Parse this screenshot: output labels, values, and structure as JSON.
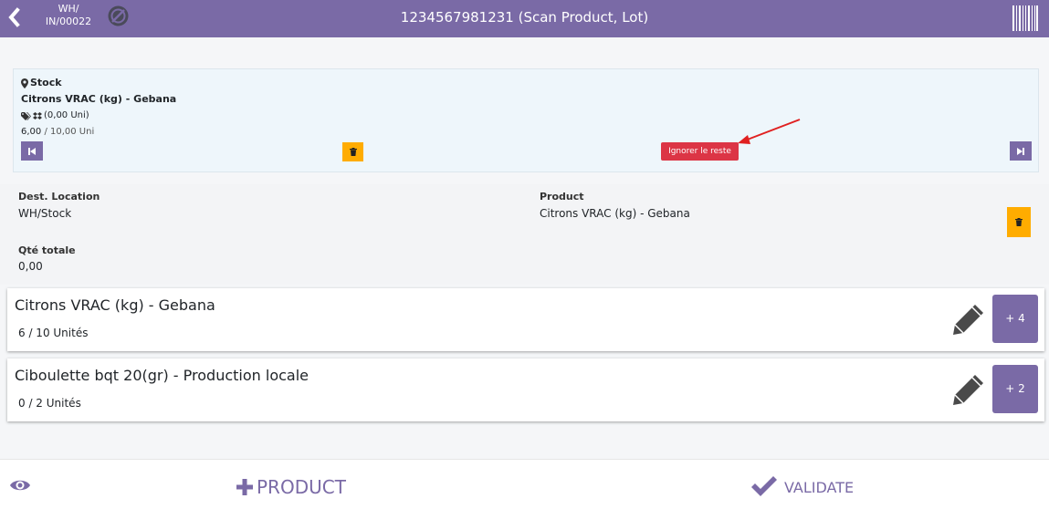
{
  "colors": {
    "primary": "#7a6aa6",
    "warning": "#ffac00",
    "danger": "#dc3545",
    "selected_bg": "#eef6fb",
    "arrow": "#e02020"
  },
  "header": {
    "reference": "WH/ IN/00022",
    "title": "1234567981231 (Scan Product, Lot)",
    "icons": [
      "chevron-left-icon",
      "no-link-icon",
      "barcode-icon"
    ]
  },
  "selected_line": {
    "location": "Stock",
    "product": "Citrons VRAC (kg) - Gebana",
    "package_qty": "(0,00 Uni)",
    "qty_done": "6,00",
    "qty_demand": "/ 10,00 Uni",
    "ignore_label": "Ignorer le reste",
    "icons": [
      "map-marker-icon",
      "tags-icon",
      "dropbox-icon",
      "step-backward-icon",
      "trash-icon",
      "step-forward-icon"
    ]
  },
  "details": {
    "dest_label": "Dest. Location",
    "dest_value": "WH/Stock",
    "product_label": "Product",
    "product_value": "Citrons VRAC (kg) - Gebana",
    "qty_label": "Qté totale",
    "qty_value": "0,00"
  },
  "lines": [
    {
      "name": "Citrons VRAC (kg) - Gebana",
      "qty": "6 / 10 Unités",
      "add_label": "+ 4"
    },
    {
      "name": "Ciboulette bqt 20(gr) - Production locale",
      "qty": "0 / 2 Unités",
      "add_label": "+ 2"
    }
  ],
  "bottom": {
    "add_product_label": "PRODUCT",
    "validate_label": "VALIDATE",
    "icons": [
      "eye-icon",
      "plus-icon",
      "check-icon"
    ]
  }
}
